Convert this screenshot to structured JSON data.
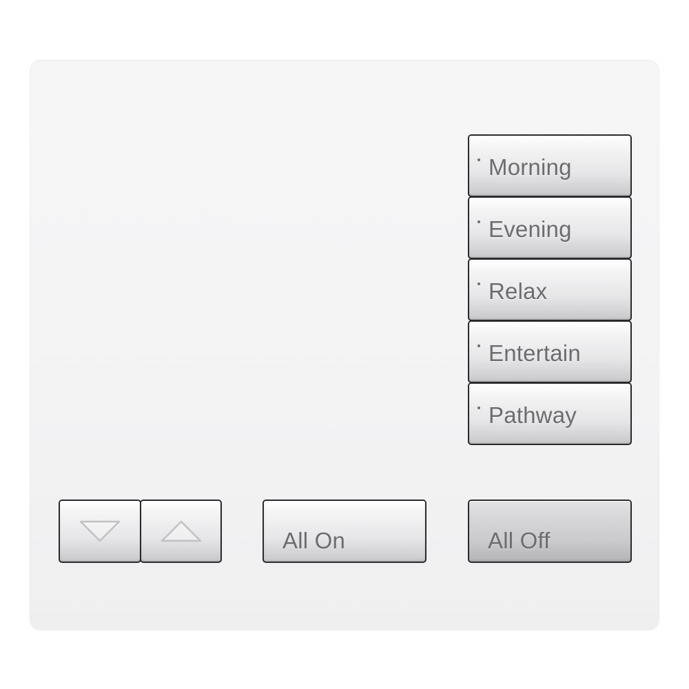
{
  "keypad": {
    "scene_buttons": [
      {
        "label": "Morning"
      },
      {
        "label": "Evening"
      },
      {
        "label": "Relax"
      },
      {
        "label": "Entertain"
      },
      {
        "label": "Pathway"
      }
    ],
    "lower_button": {
      "icon": "triangle-down-icon"
    },
    "raise_button": {
      "icon": "triangle-up-icon"
    },
    "all_on_label": "All On",
    "all_off_label": "All Off",
    "colors": {
      "faceplate": "#f4f4f5",
      "button_face": "#e6e6e8",
      "button_text": "#6c6c70",
      "button_bezel": "#2a2a2c"
    }
  }
}
